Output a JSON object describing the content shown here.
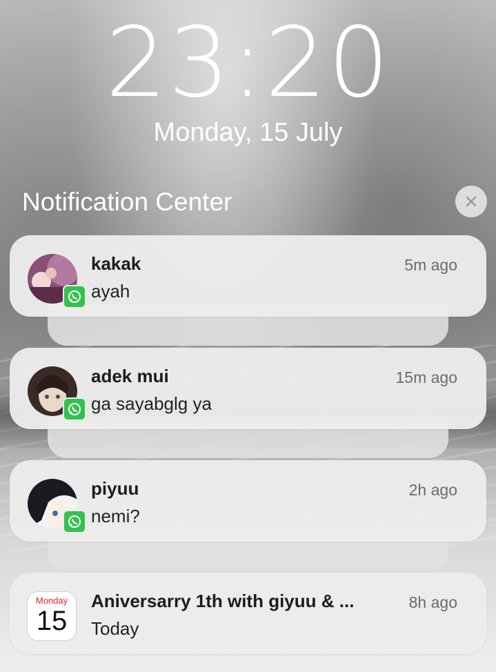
{
  "lockscreen": {
    "time": "23:20",
    "date": "Monday, 15 July"
  },
  "notification_center": {
    "title": "Notification Center",
    "close_icon": "close-icon"
  },
  "notifications": [
    {
      "app": "WhatsApp",
      "icon": "whatsapp-icon",
      "title": "kakak",
      "body": "ayah",
      "time": "5m ago"
    },
    {
      "app": "WhatsApp",
      "icon": "whatsapp-icon",
      "title": "adek mui",
      "body": "ga sayabglg ya",
      "time": "15m ago"
    },
    {
      "app": "WhatsApp",
      "icon": "whatsapp-icon",
      "title": "piyuu",
      "body": "nemi?",
      "time": "2h ago"
    },
    {
      "app": "Calendar",
      "icon": "calendar-icon",
      "calendar_day": "Monday",
      "calendar_date": "15",
      "title": "Aniversarry 1th with giyuu & ...",
      "body": "Today",
      "time": "8h ago"
    }
  ],
  "colors": {
    "whatsapp_green": "#32c24d",
    "calendar_red": "#e0281e"
  }
}
